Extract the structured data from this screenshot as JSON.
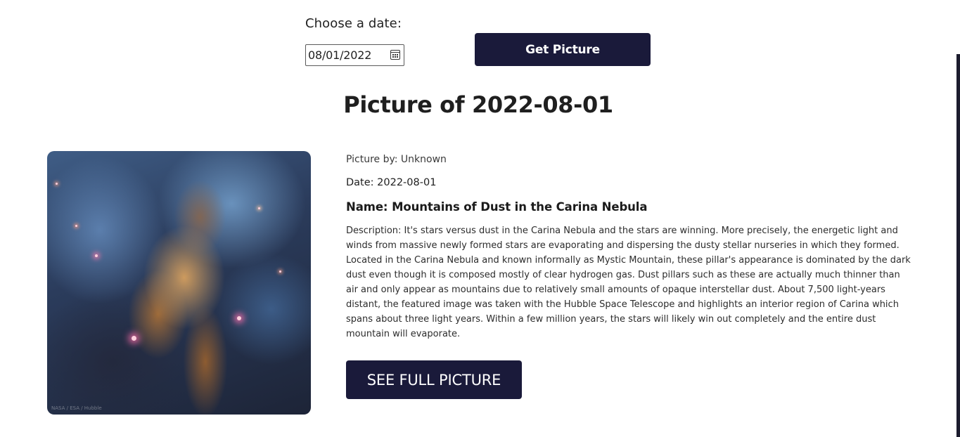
{
  "form": {
    "label": "Choose a date:",
    "date_value": "08/01/2022",
    "submit_label": "Get Picture"
  },
  "title": "Picture of 2022-08-01",
  "apod": {
    "image_credit": "NASA / ESA / Hubble",
    "credit": "Picture by: Unknown",
    "date": "Date: 2022-08-01",
    "name": "Name: Mountains of Dust in the Carina Nebula",
    "description": "Description: It's stars versus dust in the Carina Nebula and the stars are winning. More precisely, the energetic light and winds from massive newly formed stars are evaporating and dispersing the dusty stellar nurseries in which they formed. Located in the Carina Nebula and known informally as Mystic Mountain, these pillar's appearance is dominated by the dark dust even though it is composed mostly of clear hydrogen gas. Dust pillars such as these are actually much thinner than air and only appear as mountains due to relatively small amounts of opaque interstellar dust. About 7,500 light-years distant, the featured image was taken with the Hubble Space Telescope and highlights an interior region of Carina which spans about three light years. Within a few million years, the stars will likely win out completely and the entire dust mountain will evaporate.",
    "full_button_label": "SEE FULL PICTURE"
  },
  "icons": {
    "date_picker": "calendar-icon"
  },
  "colors": {
    "button_bg": "#1a1a3a",
    "button_text": "#ffffff",
    "page_bg": "#ffffff"
  }
}
